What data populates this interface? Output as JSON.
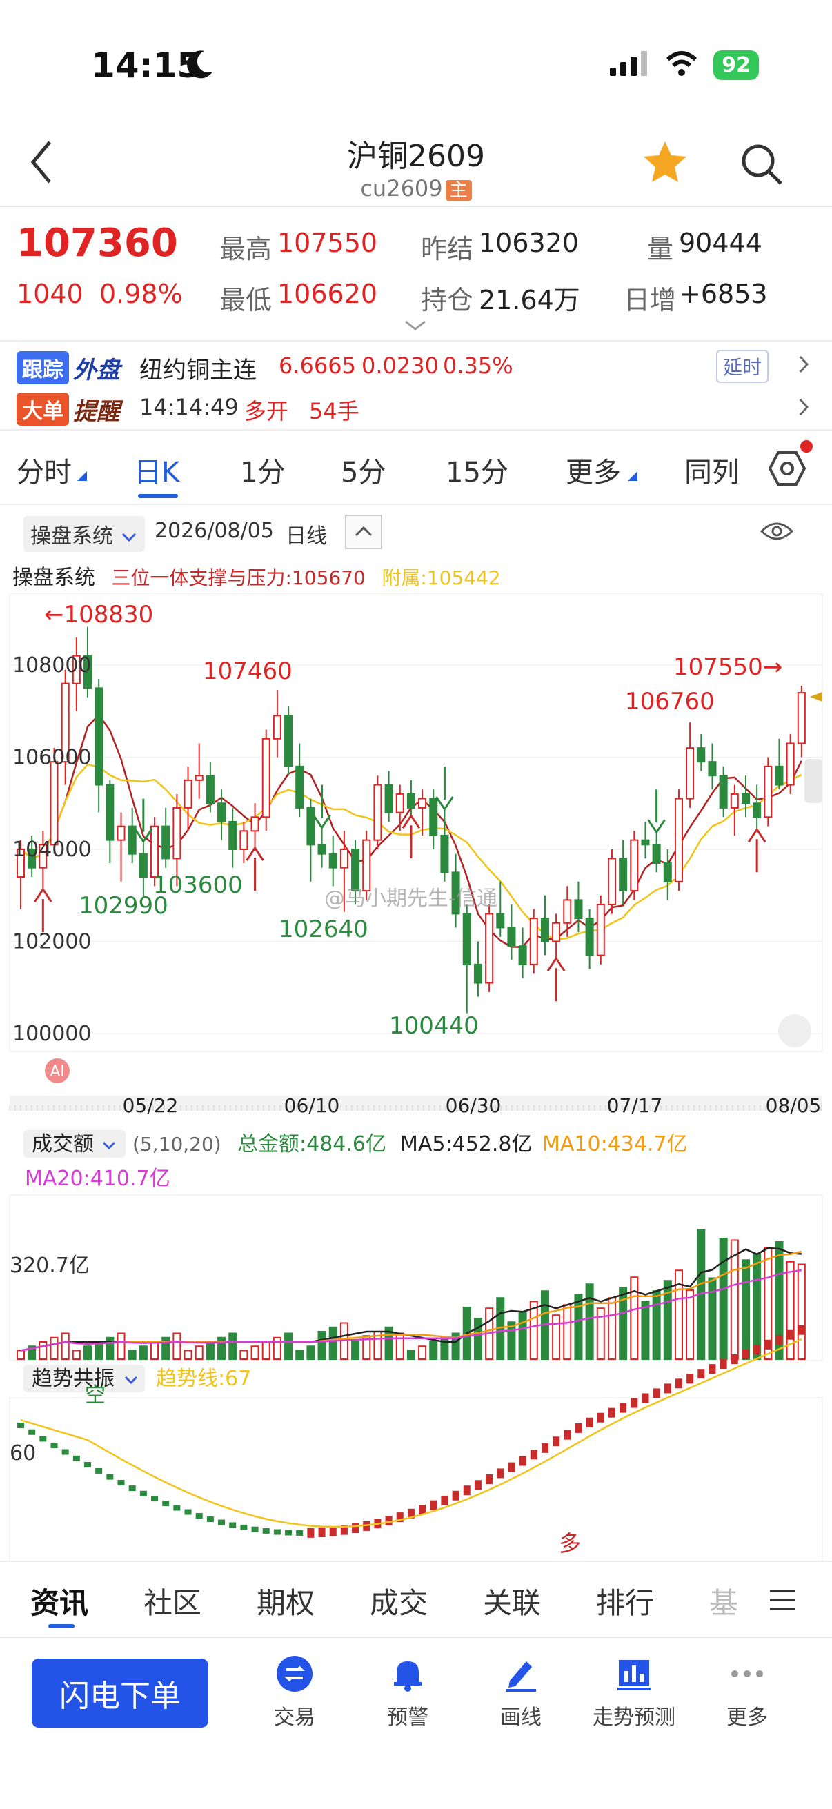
{
  "status": {
    "time": "14:15",
    "battery": "92"
  },
  "nav": {
    "title": "沪铜2609",
    "subtitle": "cu2609",
    "badge": "主"
  },
  "quote": {
    "last": "107360",
    "change": "1040",
    "change_pct": "0.98%",
    "high_label": "最高",
    "high": "107550",
    "low_label": "最低",
    "low": "106620",
    "prev_label": "昨结",
    "prev": "106320",
    "oi_label": "持仓",
    "oi": "21.64万",
    "vol_label": "量",
    "vol": "90444",
    "inc_label": "日增",
    "inc": "+6853"
  },
  "track": {
    "tag1": "跟踪",
    "tag2": "外盘",
    "name": "纽约铜主连",
    "price": "6.6665",
    "chg": "0.0230",
    "pct": "0.35%",
    "delay": "延时"
  },
  "alert": {
    "tag1": "大单",
    "tag2": "提醒",
    "time": "14:14:49",
    "action": "多开",
    "qty": "54手"
  },
  "tabs": [
    "分时",
    "日K",
    "1分",
    "5分",
    "15分",
    "更多",
    "同列"
  ],
  "chart_header": {
    "system": "操盘系统",
    "date": "2026/08/05",
    "period": "日线"
  },
  "indicator": {
    "name": "操盘系统",
    "support": "三位一体支撑与压力:105670",
    "attach": "附属:105442"
  },
  "kline": {
    "y_labels": [
      "108000",
      "106000",
      "104000",
      "102000",
      "100000"
    ],
    "annotations": {
      "a1": "←108830",
      "a2": "107460",
      "a3": "107550→",
      "a4": "106760",
      "a5": "103600",
      "a6": "102990",
      "a7": "102640",
      "a8": "100440"
    },
    "watermark": "@马小期先生-信通",
    "ai": "AI",
    "dates": [
      "05/22",
      "06/10",
      "06/30",
      "07/17",
      "08/05"
    ]
  },
  "volume": {
    "name": "成交额",
    "params": "(5,10,20)",
    "total": "总金额:484.6亿",
    "ma5": "MA5:452.8亿",
    "ma10": "MA10:434.7亿",
    "ma20": "MA20:410.7亿",
    "y_label": "320.7亿"
  },
  "trend": {
    "name": "趋势共振",
    "line": "趋势线:67",
    "y_label": "60",
    "kong": "空",
    "duo": "多"
  },
  "bottom_tabs": [
    "资讯",
    "社区",
    "期权",
    "成交",
    "关联",
    "排行",
    "基"
  ],
  "actions": {
    "order": "闪电下单",
    "items": [
      "交易",
      "预警",
      "画线",
      "走势预测",
      "更多"
    ]
  },
  "colors": {
    "up": "#e02424",
    "down": "#2b8a3e",
    "accent": "#1f5fe0",
    "ma_yellow": "#f2c319",
    "ma_pink": "#d63bd6",
    "ma_orange": "#f39c12"
  }
}
